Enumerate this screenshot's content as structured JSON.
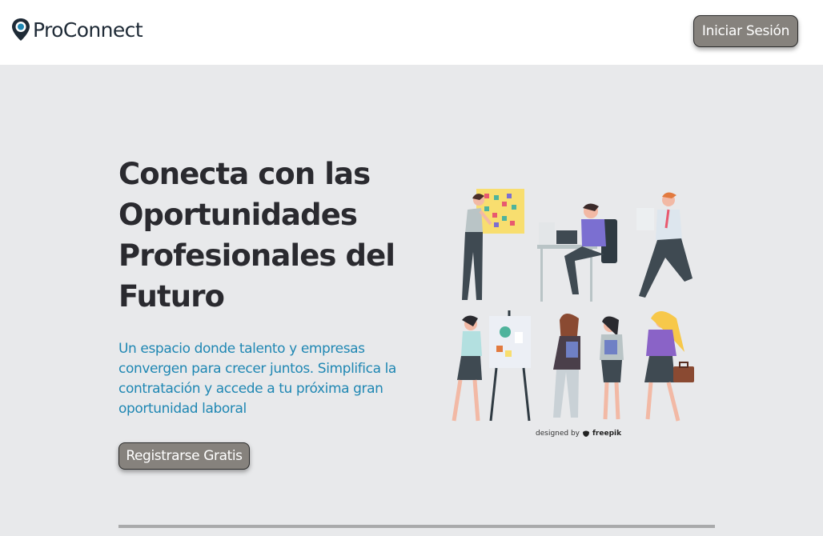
{
  "header": {
    "brand": "ProConnect",
    "login_label": "Iniciar Sesión"
  },
  "hero": {
    "title": "Conecta con las Oportunidades Profesionales del Futuro",
    "subtitle": "Un espacio donde talento y empresas convergen para crecer juntos. Simplifica la contratación y accede a tu próxima gran oportunidad laboral",
    "cta_label": "Registrarse Gratis"
  },
  "illustration": {
    "credit_prefix": "designed by",
    "credit_brand": "freepik"
  },
  "colors": {
    "accent": "#1f87b3",
    "button": "#86827d",
    "background": "#e8e9eb",
    "header": "#ffffff"
  },
  "icons": {
    "logo": "location-pin-icon",
    "freepik": "freepik-logo-icon"
  }
}
